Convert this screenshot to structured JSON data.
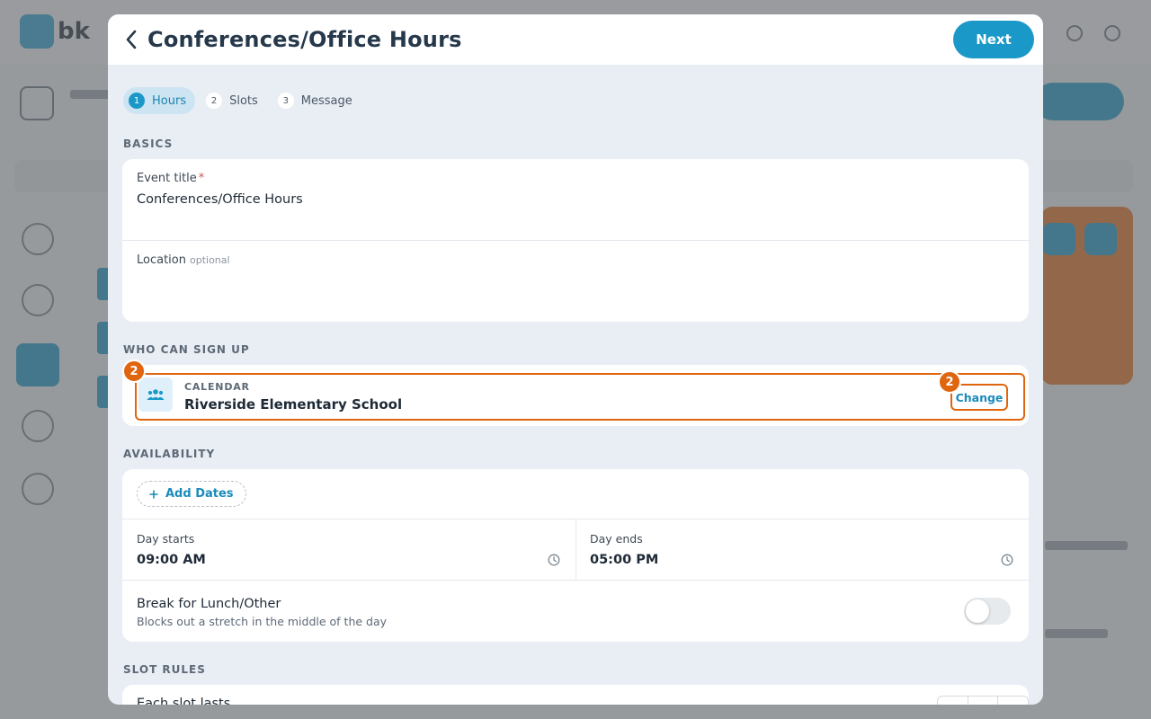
{
  "background": {
    "logo_text": "bk"
  },
  "modal": {
    "title": "Conferences/Office Hours",
    "next_label": "Next",
    "steps": [
      {
        "num": "1",
        "label": "Hours"
      },
      {
        "num": "2",
        "label": "Slots"
      },
      {
        "num": "3",
        "label": "Message"
      }
    ],
    "basics": {
      "section_label": "BASICS",
      "event_title_label": "Event title",
      "required_mark": "*",
      "event_title_value": "Conferences/Office Hours",
      "location_label": "Location",
      "location_optional": "optional",
      "location_value": ""
    },
    "signup": {
      "section_label": "WHO CAN SIGN UP",
      "calendar_caption": "CALENDAR",
      "calendar_name": "Riverside Elementary School",
      "change_label": "Change",
      "badge_text": "2"
    },
    "availability": {
      "section_label": "AVAILABILITY",
      "add_dates_label": "Add Dates",
      "day_starts_label": "Day starts",
      "day_starts_value": "09:00 AM",
      "day_ends_label": "Day ends",
      "day_ends_value": "05:00 PM",
      "break_title": "Break for Lunch/Other",
      "break_subtitle": "Blocks out a stretch in the middle of the day",
      "break_enabled": false
    },
    "slot_rules": {
      "section_label": "SLOT RULES",
      "each_slot_label": "Each slot lasts"
    }
  },
  "colors": {
    "accent": "#1a99c8",
    "highlight": "#e0650f",
    "modal_bg": "#e9eef5"
  }
}
